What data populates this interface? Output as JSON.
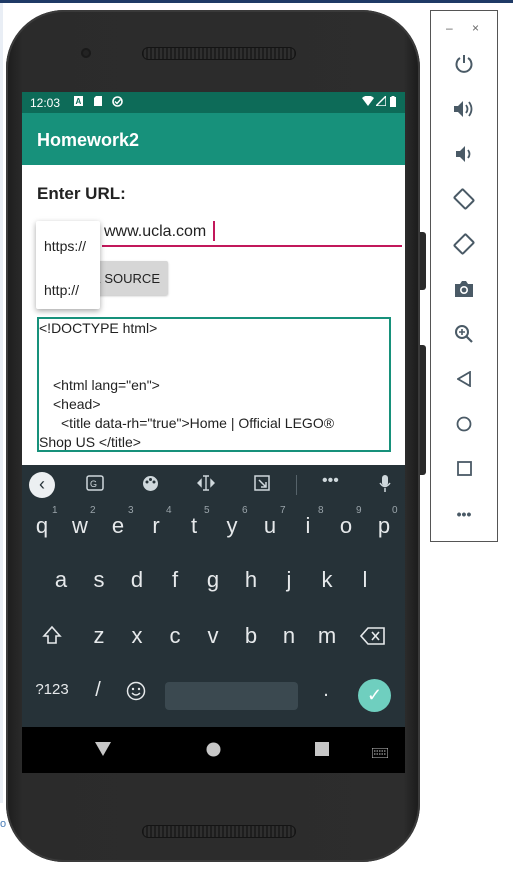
{
  "status_bar": {
    "time": "12:03",
    "icons": [
      "text-notification-icon",
      "sd-card-icon",
      "sync-icon",
      "wifi-icon",
      "signal-icon",
      "battery-icon"
    ]
  },
  "app_bar": {
    "title": "Homework2"
  },
  "form": {
    "label": "Enter URL:",
    "url_value": "www.ucla.com",
    "button_label": "VIEW SOURCE",
    "button_visible_text": "E SOURCE"
  },
  "autocomplete": {
    "options": [
      "https://",
      "http://"
    ]
  },
  "source_lines": [
    "<!DOCTYPE html>",
    "<html lang=\"en\">",
    "<head>",
    "<title data-rh=\"true\">Home | Official LEGO®",
    "Shop US </title>"
  ],
  "keyboard": {
    "row1": [
      {
        "key": "q",
        "hint": "1"
      },
      {
        "key": "w",
        "hint": "2"
      },
      {
        "key": "e",
        "hint": "3"
      },
      {
        "key": "r",
        "hint": "4"
      },
      {
        "key": "t",
        "hint": "5"
      },
      {
        "key": "y",
        "hint": "6"
      },
      {
        "key": "u",
        "hint": "7"
      },
      {
        "key": "i",
        "hint": "8"
      },
      {
        "key": "o",
        "hint": "9"
      },
      {
        "key": "p",
        "hint": "0"
      }
    ],
    "row2": [
      "a",
      "s",
      "d",
      "f",
      "g",
      "h",
      "j",
      "k",
      "l"
    ],
    "row3": [
      "z",
      "x",
      "c",
      "v",
      "b",
      "n",
      "m"
    ],
    "symbols_label": "?123",
    "slash_label": "/",
    "period_label": ".",
    "toolbar_icons": [
      "back-chevron-icon",
      "translate-icon",
      "palette-icon",
      "cursor-control-icon",
      "resize-icon",
      "more-icon",
      "mic-icon"
    ]
  },
  "nav_bar": {
    "icons": [
      "back-icon",
      "home-icon",
      "recents-icon",
      "keyboard-switch-icon"
    ]
  },
  "emulator_panel": {
    "window_controls": {
      "minimize": "–",
      "close": "×"
    },
    "buttons": [
      "power-icon",
      "volume-up-icon",
      "volume-down-icon",
      "rotate-left-icon",
      "rotate-right-icon",
      "camera-icon",
      "zoom-icon",
      "back-icon",
      "home-icon",
      "overview-icon",
      "more-icon"
    ]
  },
  "colors": {
    "primary": "#17917b",
    "primary_dark": "#0d6b58",
    "accent": "#c2185b",
    "keyboard_bg": "#263238",
    "enter_key": "#6fcfbf"
  }
}
